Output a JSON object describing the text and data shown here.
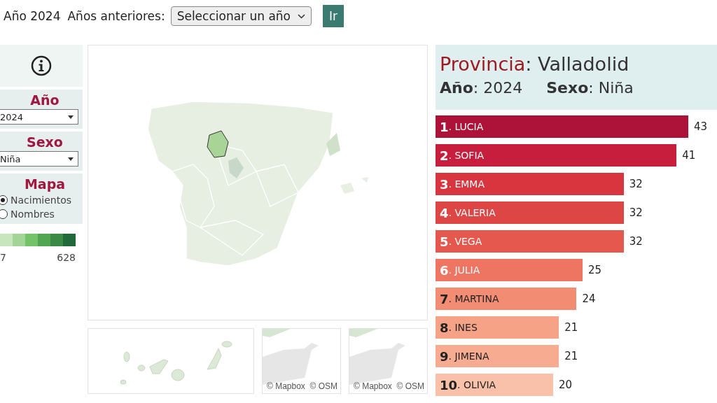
{
  "top_bar": {
    "current_year": "Año 2024",
    "previous_label": "Años anteriores:",
    "year_select": {
      "value": "Seleccionar un año"
    },
    "go_button": "Ir"
  },
  "sidebar": {
    "filters": [
      {
        "label": "Año",
        "value": "2024"
      },
      {
        "label": "Sexo",
        "value": "Niña"
      }
    ],
    "map_mode": {
      "label": "Mapa",
      "options": [
        {
          "label": "Nacimientos",
          "selected": true
        },
        {
          "label": "Nombres",
          "selected": false
        }
      ]
    },
    "legend": {
      "min": "7",
      "max": "628",
      "swatches": [
        {
          "color": "#c7e6be"
        },
        {
          "color": "#a3d696"
        },
        {
          "color": "#74c26a"
        },
        {
          "color": "#52a652"
        },
        {
          "color": "#3a8a46"
        },
        {
          "color": "#22693a"
        }
      ]
    }
  },
  "map": {
    "insets": [
      {
        "kind": "islands"
      },
      {
        "kind": "coast",
        "attribution": "© Mapbox  © OSM"
      },
      {
        "kind": "coast",
        "attribution": "© Mapbox  © OSM"
      }
    ]
  },
  "panel": {
    "province_title": "**Provincia**: Valladolid",
    "year_summary": "**Año**: 2024",
    "sex_summary": "**Sexo**: Niña",
    "ranking": [
      {
        "label": "**1**. LUCIA",
        "value": "43",
        "color": "#ad1238"
      },
      {
        "label": "**2**. SOFIA",
        "value": "41",
        "color": "#c71e3e"
      },
      {
        "label": "**3**. EMMA",
        "value": "32",
        "color": "#d8353f"
      },
      {
        "label": "**4**. VALERIA",
        "value": "32",
        "color": "#de4545"
      },
      {
        "label": "**5**. VEGA",
        "value": "32",
        "color": "#e5584d"
      },
      {
        "label": "**6**. JULIA",
        "value": "25",
        "color": "#ed7562"
      },
      {
        "label": "**7**. MARTINA",
        "value": "24",
        "color": "#f28d74"
      },
      {
        "label": "**8**. INES",
        "value": "21",
        "color": "#f6a287"
      },
      {
        "label": "**9**. JIMENA",
        "value": "21",
        "color": "#f7ac92"
      },
      {
        "label": "**10**. OLIVIA",
        "value": "20",
        "color": "#fac1aa"
      }
    ]
  }
}
